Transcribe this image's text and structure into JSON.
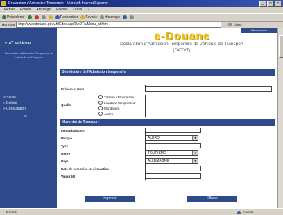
{
  "window": {
    "title": "Déclaration d'Admission Temporaire - Microsoft Internet Explorer",
    "controls": [
      "_",
      "□",
      "×"
    ]
  },
  "menu": [
    "Fichier",
    "Edition",
    "Affichage",
    "Favoris",
    "Outils",
    "?"
  ],
  "toolbar": {
    "back": "Précédente",
    "search": "Rechercher",
    "favorites": "Favoris",
    "history": "Historique"
  },
  "address": {
    "label": "Adresse",
    "url": "http://www.douane.gouv.fr/Edoc.asp/DAOTA/Menu_at.htm",
    "go": "OK",
    "links": "Liens"
  },
  "sidebar": {
    "logo": "AT Véhicule",
    "tagline": "Déclaration d'Admission Temporaire de Véhicule de Transport",
    "nav": [
      "Saisie",
      "Edition",
      "Consultation"
    ]
  },
  "header": {
    "user": "Déconnexion",
    "brand": "e-Douane",
    "doc_title": "Déclaration d'Admission Temporaire de Véhicule de Transport",
    "doc_code": "(DATVT)"
  },
  "section1": {
    "title": "Bénéficiaire de l'Admission temporaire",
    "name_label": "Prénom et Nom",
    "qualite_label": "Qualité",
    "options": [
      "Titulaire / Propriétaire",
      "Locataire / Emprunteur",
      "Mandataire",
      "Autres"
    ]
  },
  "section2": {
    "title": "Moyen(s) de Transport",
    "fields": [
      {
        "label": "Immatriculation",
        "value": ""
      },
      {
        "label": "Marque",
        "value": "ALERO"
      },
      {
        "label": "Type",
        "value": ""
      },
      {
        "label": "Genre",
        "value": "TOURISME"
      },
      {
        "label": "Pays",
        "value": "ALLEMAGNE"
      },
      {
        "label": "Date de 1ère mise en circulation",
        "value": ""
      },
      {
        "label": "Valeur (€)",
        "value": ""
      }
    ]
  },
  "buttons": {
    "print": "Imprimer",
    "clear": "Effacer"
  },
  "status": {
    "left": "Terminé",
    "right": "Internet"
  }
}
